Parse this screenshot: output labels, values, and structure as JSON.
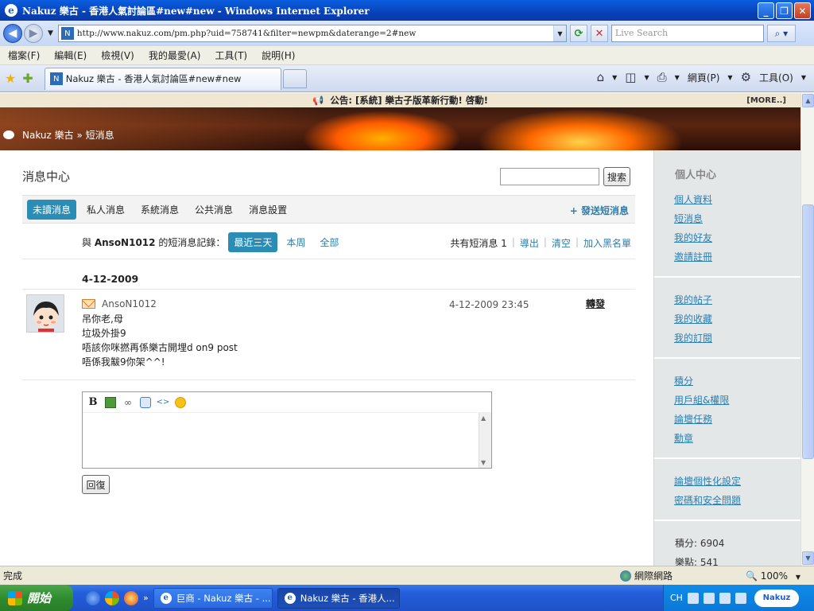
{
  "window": {
    "title": "Nakuz 樂古 - 香港人氣討論區#new#new - Windows Internet Explorer",
    "ie_glyph": "e",
    "buttons": {
      "minimize": "_",
      "restore": "❐",
      "close": "✕"
    }
  },
  "addressbar": {
    "url": "http://www.nakuz.com/pm.php?uid=758741&filter=newpm&daterange=2#new",
    "search_placeholder": "Live Search"
  },
  "menu": [
    "檔案(F)",
    "編輯(E)",
    "檢視(V)",
    "我的最愛(A)",
    "工具(T)",
    "說明(H)"
  ],
  "tab": {
    "title": "Nakuz 樂古 - 香港人氣討論區#new#new"
  },
  "commandbar": {
    "page_label": "網頁(P)",
    "tools_label": "工具(O)"
  },
  "announcement": {
    "text": "公告: [系統] 樂古子版革新行動! 啓動!",
    "more": "[MORE..]"
  },
  "breadcrumb": "Nakuz 樂古 » 短消息",
  "pm": {
    "title": "消息中心",
    "search_button": "搜索",
    "tabs": [
      "未讀消息",
      "私人消息",
      "系統消息",
      "公共消息",
      "消息設置"
    ],
    "active_tab_index": 0,
    "send_label": "+ 發送短消息",
    "filter": {
      "prefix": "與",
      "user": "AnsoN1012",
      "suffix": "的短消息記錄：",
      "ranges": [
        "最近三天",
        "本周",
        "全部"
      ],
      "active_range_index": 0
    },
    "summary": {
      "count_label": "共有短消息 1",
      "export": "導出",
      "clear": "清空",
      "blacklist": "加入黑名單"
    },
    "date_group": "4-12-2009",
    "message": {
      "from": "AnsoN1012",
      "time": "4-12-2009 23:45",
      "forward": "轉發",
      "lines": [
        "吊你老,母",
        "垃圾外掛9",
        "唔該你咪撚再係樂古開埋d on9 post",
        "唔係我黻9你架^^!"
      ]
    },
    "reply_button": "回復"
  },
  "sidebar": {
    "heading": "個人中心",
    "groups": [
      [
        "個人資料",
        "短消息",
        "我的好友",
        "邀請註冊"
      ],
      [
        "我的帖子",
        "我的收藏",
        "我的訂閱"
      ],
      [
        "積分",
        "用戶組&權限",
        "論壇任務",
        "勳章"
      ],
      [
        "論壇個性化設定",
        "密碼和安全問題"
      ]
    ],
    "stats": [
      "積分: 6904",
      "樂點: 541"
    ]
  },
  "statusbar": {
    "status": "完成",
    "zone": "網際網路",
    "zoom": "100%"
  },
  "taskbar": {
    "start": "開始",
    "items": [
      "巨商 - Nakuz 樂古 - ...",
      "Nakuz 樂古 - 香港人..."
    ],
    "lang": "CH",
    "logo": "Nakuz"
  }
}
